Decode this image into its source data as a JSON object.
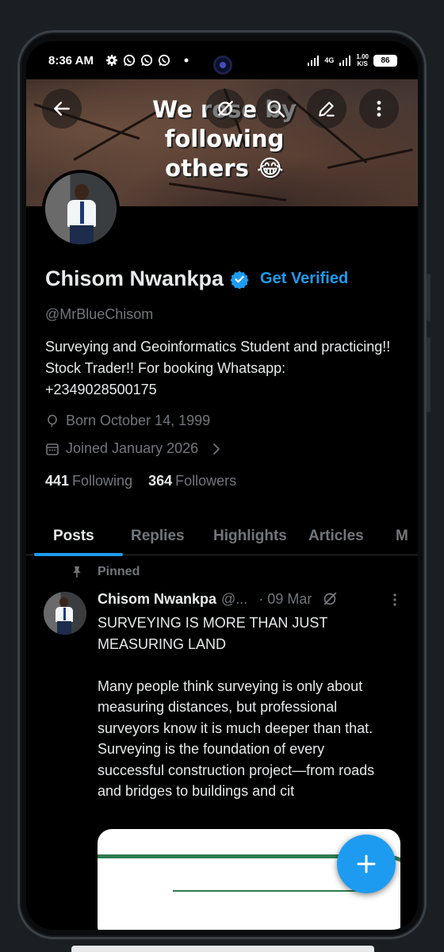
{
  "status_bar": {
    "time": "8:36 AM",
    "network_label": "4G",
    "net_speed_value": "1.00",
    "net_speed_unit": "K/S",
    "battery": "86",
    "icons": [
      "gear-icon",
      "whatsapp-icon",
      "whatsapp-business-icon",
      "whatsapp-icon",
      "dot-icon",
      "signal-icon",
      "signal-4g-icon"
    ]
  },
  "banner": {
    "text_line1": "We rose by",
    "text_line2": "following",
    "text_line3": "others 😂",
    "buttons": [
      "back-arrow-icon",
      "grok-icon",
      "search-icon",
      "edit-icon",
      "more-vertical-icon"
    ]
  },
  "profile": {
    "name": "Chisom Nwankpa",
    "get_verified": "Get Verified",
    "handle": "@MrBlueChisom",
    "bio": "Surveying and Geoinformatics Student and practicing!! Stock Trader!! For booking Whatsapp: +2349028500175",
    "born": "Born October 14, 1999",
    "joined": "Joined January 2026",
    "following_count": "441",
    "following_label": "Following",
    "followers_count": "364",
    "followers_label": "Followers"
  },
  "tabs": [
    {
      "label": "Posts",
      "active": true
    },
    {
      "label": "Replies",
      "active": false
    },
    {
      "label": "Highlights",
      "active": false
    },
    {
      "label": "Articles",
      "active": false
    },
    {
      "label": "M",
      "active": false
    }
  ],
  "post": {
    "pinned_label": "Pinned",
    "author": "Chisom Nwankpa",
    "handle": "@...",
    "date": "· 09 Mar",
    "text": "SURVEYING IS MORE THAN JUST MEASURING LAND\n\nMany people think surveying is only about measuring distances, but professional surveyors know it is much deeper than that. Surveying is the foundation of every successful construction project—from roads and bridges to buildings and cit"
  },
  "colors": {
    "accent": "#1d9bf0",
    "background": "#000000",
    "text_primary": "#e7e9ea",
    "text_secondary": "#71767b",
    "divider": "#2f3336",
    "media_line": "#2e7b52"
  }
}
